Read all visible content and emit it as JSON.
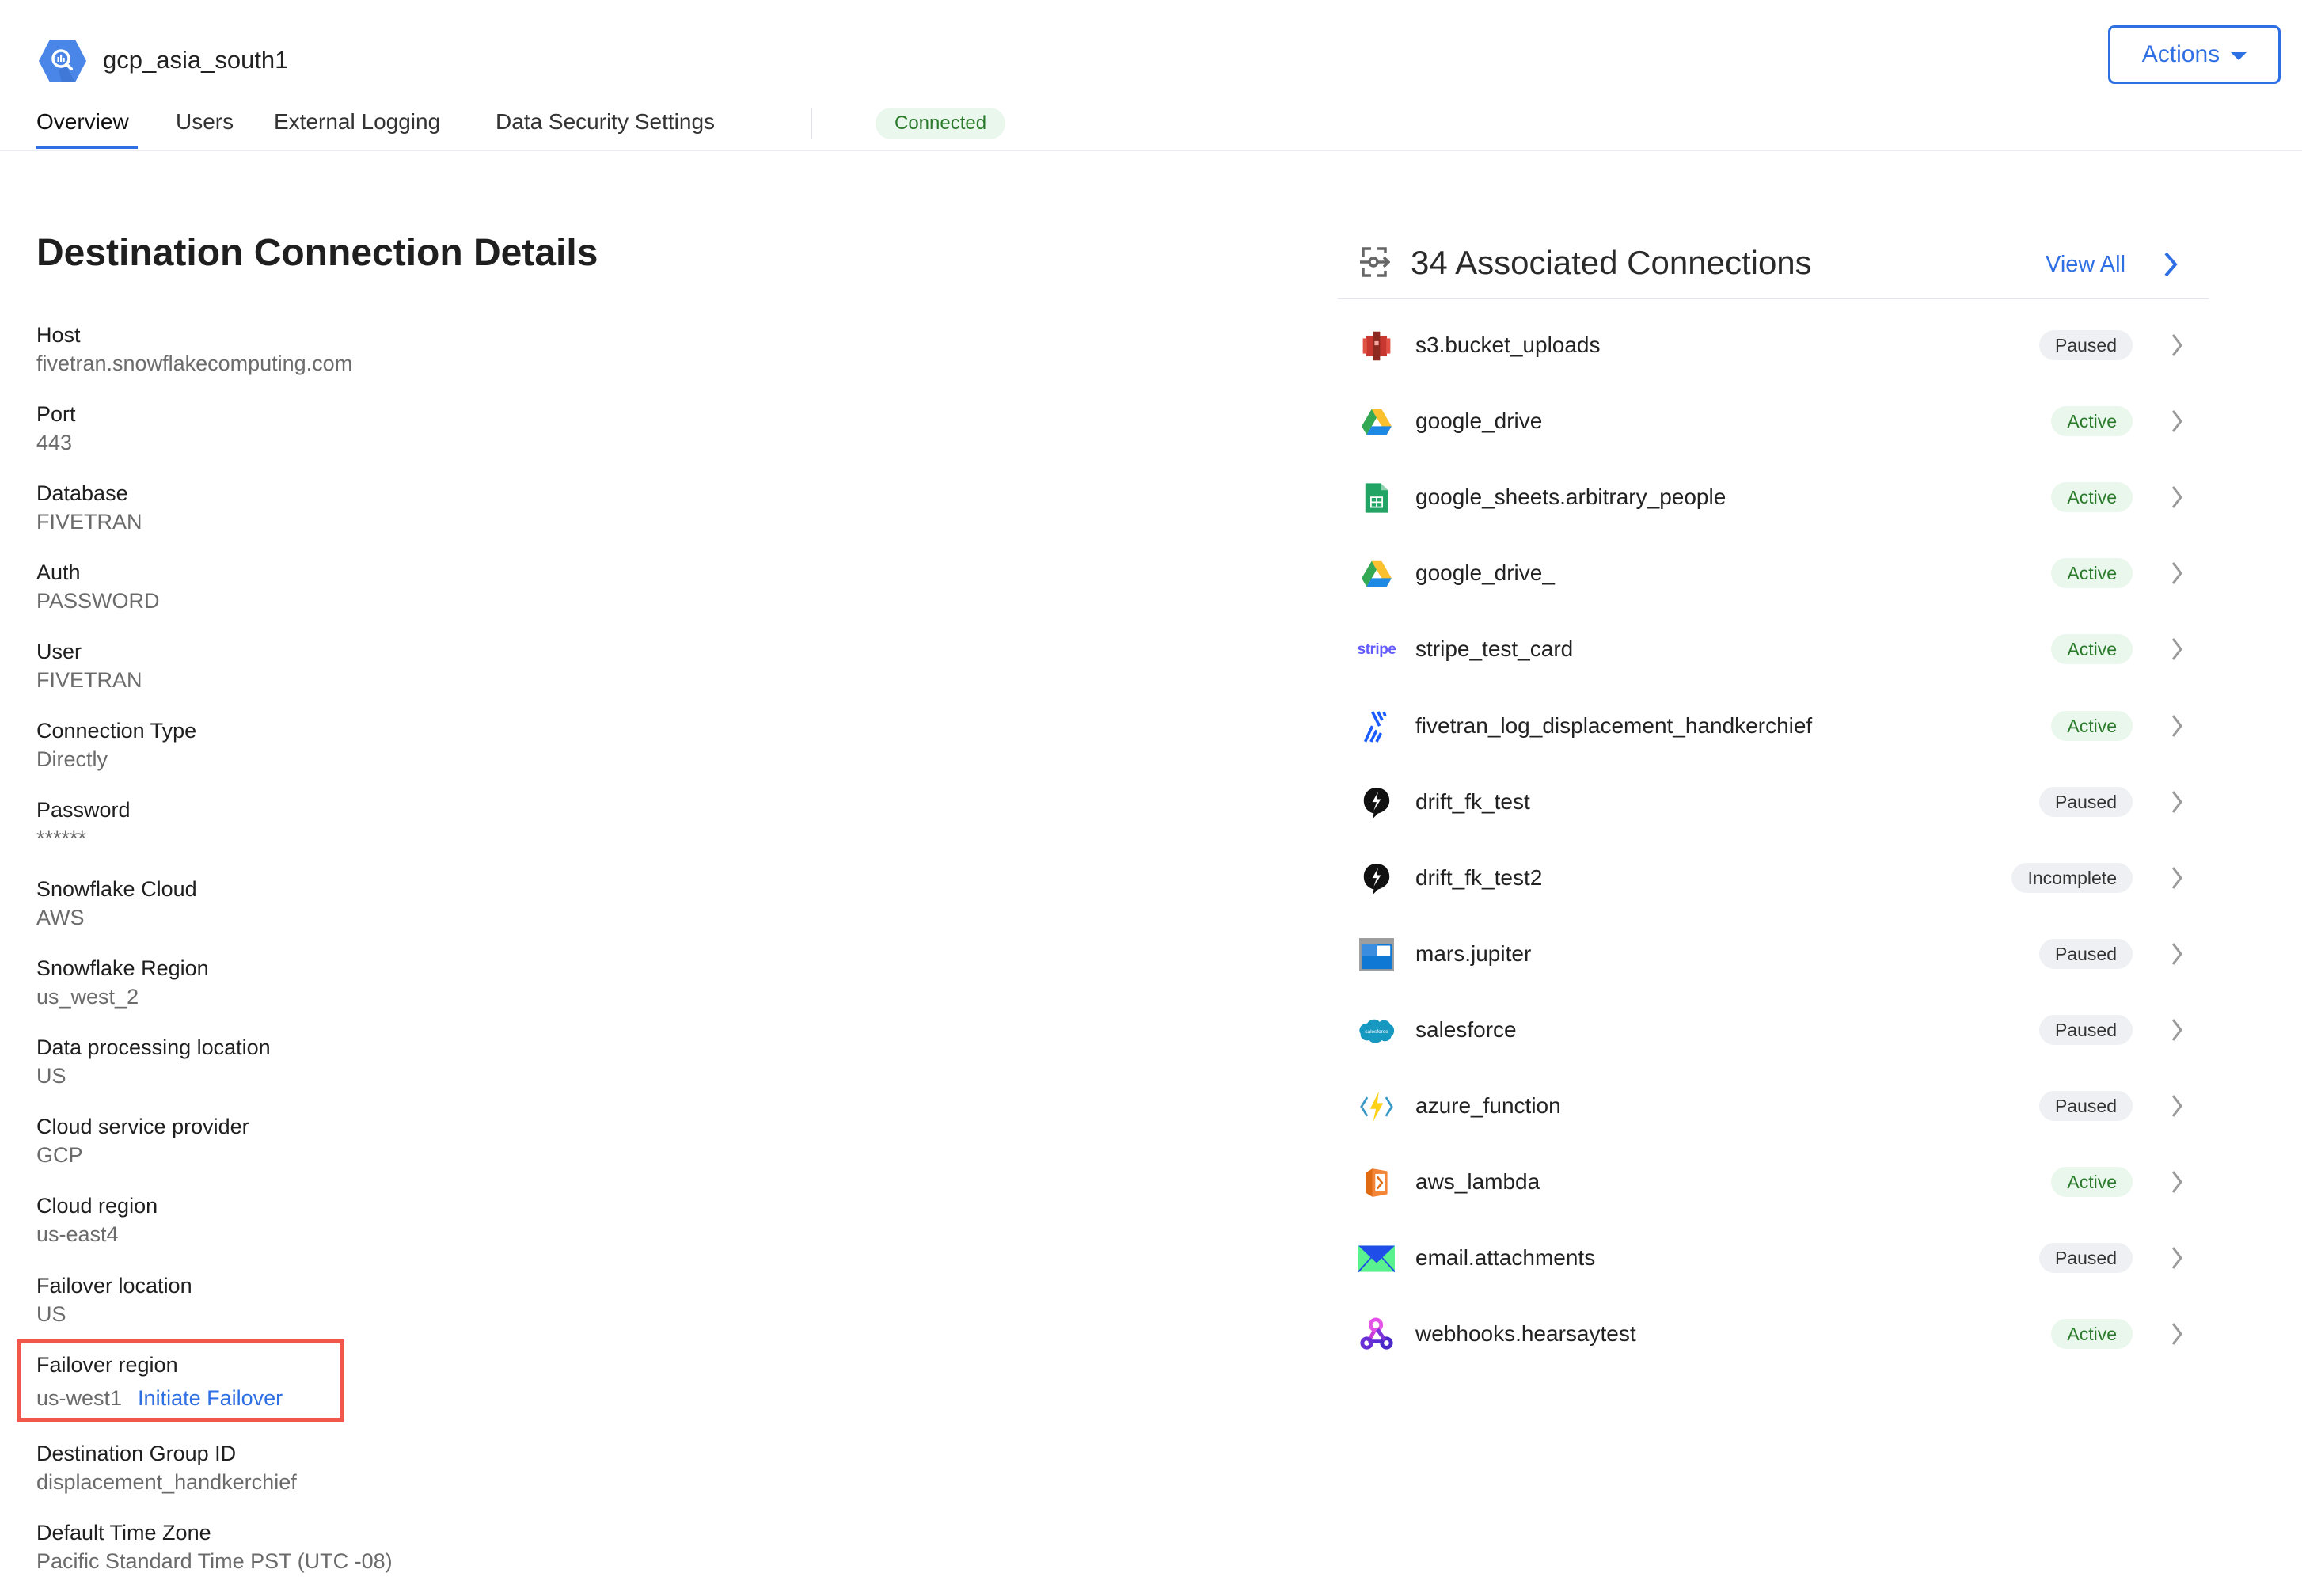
{
  "header": {
    "title": "gcp_asia_south1",
    "logo_icon": "bigquery-hexagon-icon",
    "tabs": [
      {
        "label": "Overview",
        "active": true
      },
      {
        "label": "Users",
        "active": false
      },
      {
        "label": "External Logging",
        "active": false
      },
      {
        "label": "Data Security Settings",
        "active": false
      }
    ],
    "status": "Connected",
    "actions_label": "Actions"
  },
  "details": {
    "title": "Destination Connection Details",
    "fields": [
      {
        "label": "Host",
        "value": "fivetran.snowflakecomputing.com"
      },
      {
        "label": "Port",
        "value": "443"
      },
      {
        "label": "Database",
        "value": "FIVETRAN"
      },
      {
        "label": "Auth",
        "value": "PASSWORD"
      },
      {
        "label": "User",
        "value": "FIVETRAN"
      },
      {
        "label": "Connection Type",
        "value": "Directly"
      },
      {
        "label": "Password",
        "value": "******"
      },
      {
        "label": "Snowflake Cloud",
        "value": "AWS"
      },
      {
        "label": "Snowflake Region",
        "value": "us_west_2"
      },
      {
        "label": "Data processing location",
        "value": "US"
      },
      {
        "label": "Cloud service provider",
        "value": "GCP"
      },
      {
        "label": "Cloud region",
        "value": "us-east4"
      },
      {
        "label": "Failover location",
        "value": "US"
      },
      {
        "label": "Failover region",
        "value": "us-west1",
        "link": "Initiate Failover"
      },
      {
        "label": "Destination Group ID",
        "value": "displacement_handkerchief"
      },
      {
        "label": "Default Time Zone",
        "value": "Pacific Standard Time PST (UTC -08)"
      }
    ]
  },
  "connections": {
    "title": "34 Associated Connections",
    "view_all": "View All",
    "items": [
      {
        "name": "s3.bucket_uploads",
        "status": "Paused",
        "icon": "aws-s3-icon"
      },
      {
        "name": "google_drive",
        "status": "Active",
        "icon": "google-drive-icon"
      },
      {
        "name": "google_sheets.arbitrary_people",
        "status": "Active",
        "icon": "google-sheets-icon"
      },
      {
        "name": "google_drive_",
        "status": "Active",
        "icon": "google-drive-icon"
      },
      {
        "name": "stripe_test_card",
        "status": "Active",
        "icon": "stripe-icon",
        "icon_text": "stripe"
      },
      {
        "name": "fivetran_log_displacement_handkerchief",
        "status": "Active",
        "icon": "fivetran-icon"
      },
      {
        "name": "drift_fk_test",
        "status": "Paused",
        "icon": "drift-icon"
      },
      {
        "name": "drift_fk_test2",
        "status": "Incomplete",
        "icon": "drift-icon"
      },
      {
        "name": "mars.jupiter",
        "status": "Paused",
        "icon": "azure-table-icon"
      },
      {
        "name": "salesforce",
        "status": "Paused",
        "icon": "salesforce-icon",
        "icon_text": "salesforce"
      },
      {
        "name": "azure_function",
        "status": "Paused",
        "icon": "azure-function-icon"
      },
      {
        "name": "aws_lambda",
        "status": "Active",
        "icon": "aws-lambda-icon"
      },
      {
        "name": "email.attachments",
        "status": "Paused",
        "icon": "email-icon"
      },
      {
        "name": "webhooks.hearsaytest",
        "status": "Active",
        "icon": "webhooks-icon"
      }
    ]
  },
  "colors": {
    "accent": "#2f6fe4",
    "active_bg": "#e9f7ec",
    "active_text": "#2b7a2b",
    "paused_bg": "#eef0f4",
    "highlight_box": "#f0564a"
  }
}
